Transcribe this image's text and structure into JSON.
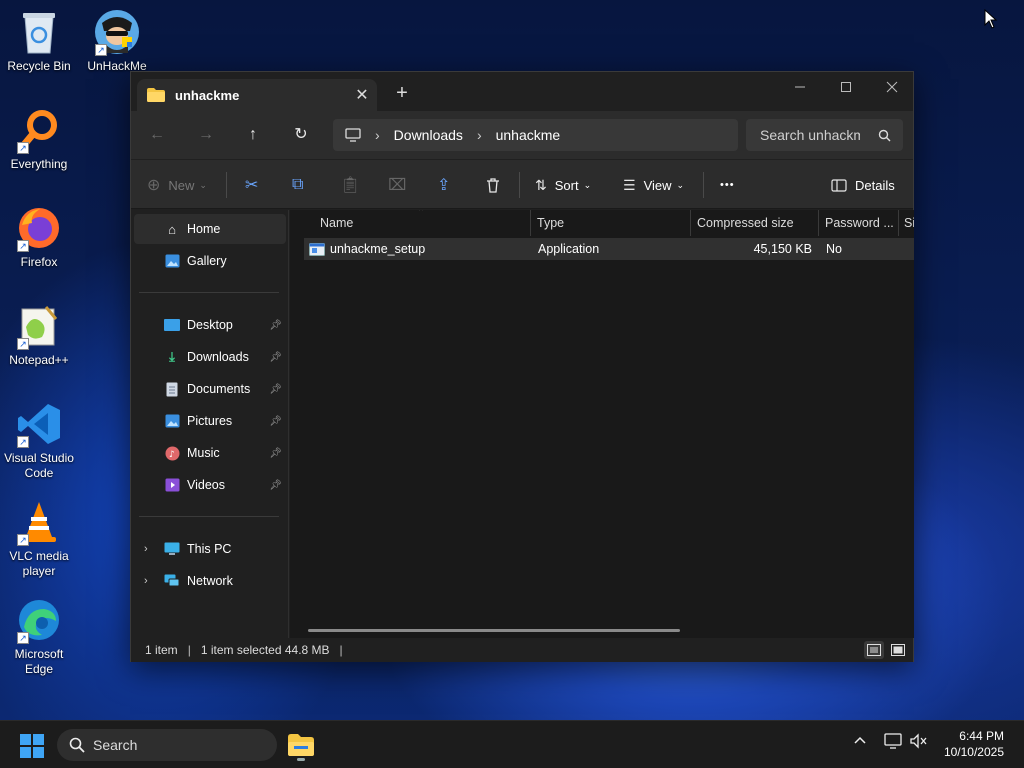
{
  "desktop": {
    "icons": [
      {
        "label": "Recycle Bin"
      },
      {
        "label": "UnHackMe"
      },
      {
        "label": "Everything"
      },
      {
        "label": "Firefox"
      },
      {
        "label": "Notepad++"
      },
      {
        "label": "Visual Studio Code"
      },
      {
        "label": "VLC media player"
      },
      {
        "label": "Microsoft Edge"
      }
    ]
  },
  "window": {
    "tab_title": "unhackme",
    "new_tab_symbol": "+",
    "close_tab_symbol": "✕",
    "breadcrumb": [
      "Downloads",
      "unhackme"
    ],
    "search_placeholder": "Search unhackme",
    "commands": {
      "new": "New",
      "sort": "Sort",
      "view": "View",
      "more": "•••",
      "details": "Details"
    },
    "nav": {
      "home": "Home",
      "gallery": "Gallery",
      "pinned": [
        {
          "label": "Desktop"
        },
        {
          "label": "Downloads"
        },
        {
          "label": "Documents"
        },
        {
          "label": "Pictures"
        },
        {
          "label": "Music"
        },
        {
          "label": "Videos"
        }
      ],
      "this_pc": "This PC",
      "network": "Network"
    },
    "columns": {
      "name": "Name",
      "type": "Type",
      "compressed_size": "Compressed size",
      "password": "Password ...",
      "size": "Si"
    },
    "files": [
      {
        "name": "unhackme_setup",
        "type": "Application",
        "compressed_size": "45,150 KB",
        "password": "No"
      }
    ],
    "status": {
      "count": "1 item",
      "selected": "1 item selected 44.8 MB"
    }
  },
  "taskbar": {
    "search_label": "Search",
    "time": "6:44 PM",
    "date": "10/10/2025"
  },
  "colors": {
    "accent": "#6aa6ff",
    "window_bg": "#202020",
    "folder_yellow": "#f4c542"
  }
}
